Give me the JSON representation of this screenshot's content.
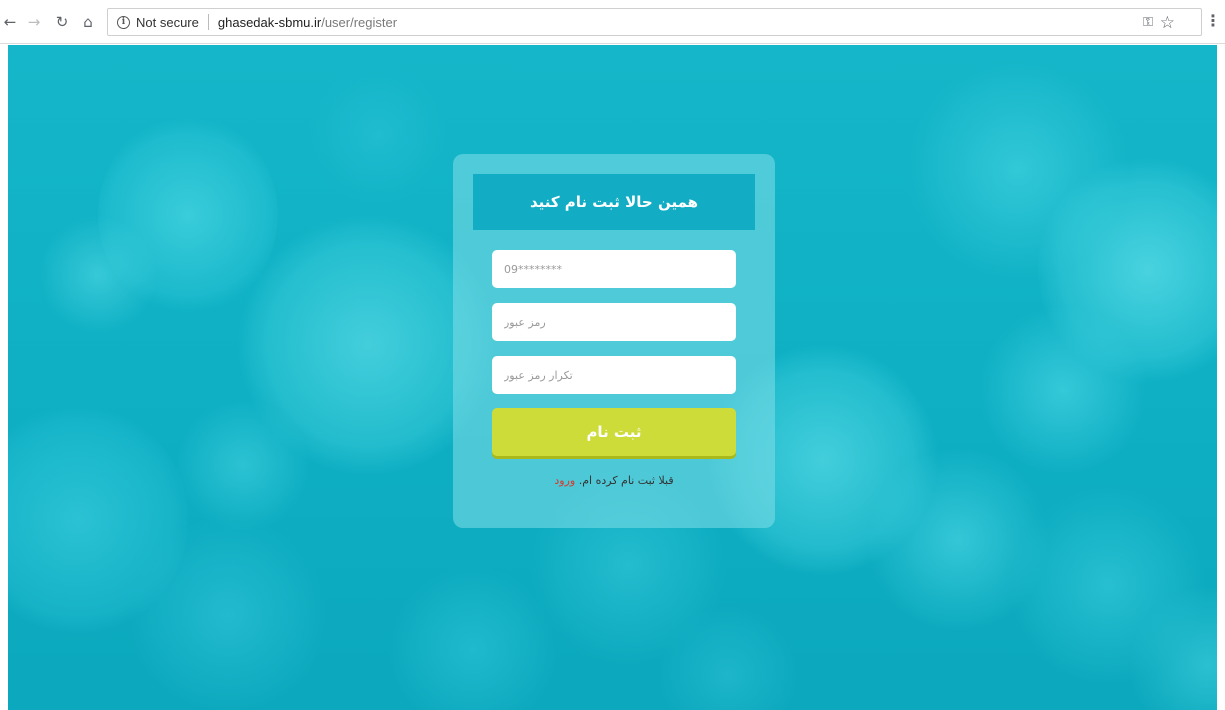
{
  "browser": {
    "security_label": "Not secure",
    "url_host": "ghasedak-sbmu.ir",
    "url_path": "/user/register",
    "icons": [
      "back-icon",
      "forward-icon",
      "reload-icon",
      "home-icon",
      "info-icon",
      "key-icon",
      "star-icon",
      "menu-icon"
    ]
  },
  "form": {
    "title": "همین حالا ثبت نام کنید",
    "phone_placeholder": "09********",
    "password_placeholder": "رمز عبور",
    "confirm_placeholder": "تکرار رمز عبور",
    "submit_label": "ثبت نام",
    "already_registered_text": "قبلا ثبت نام کرده ام.",
    "login_link": "ورود"
  },
  "colors": {
    "background": "#10b0c4",
    "header": "#12adc4",
    "submit": "#cddc39",
    "login_link": "#d43b2e"
  }
}
